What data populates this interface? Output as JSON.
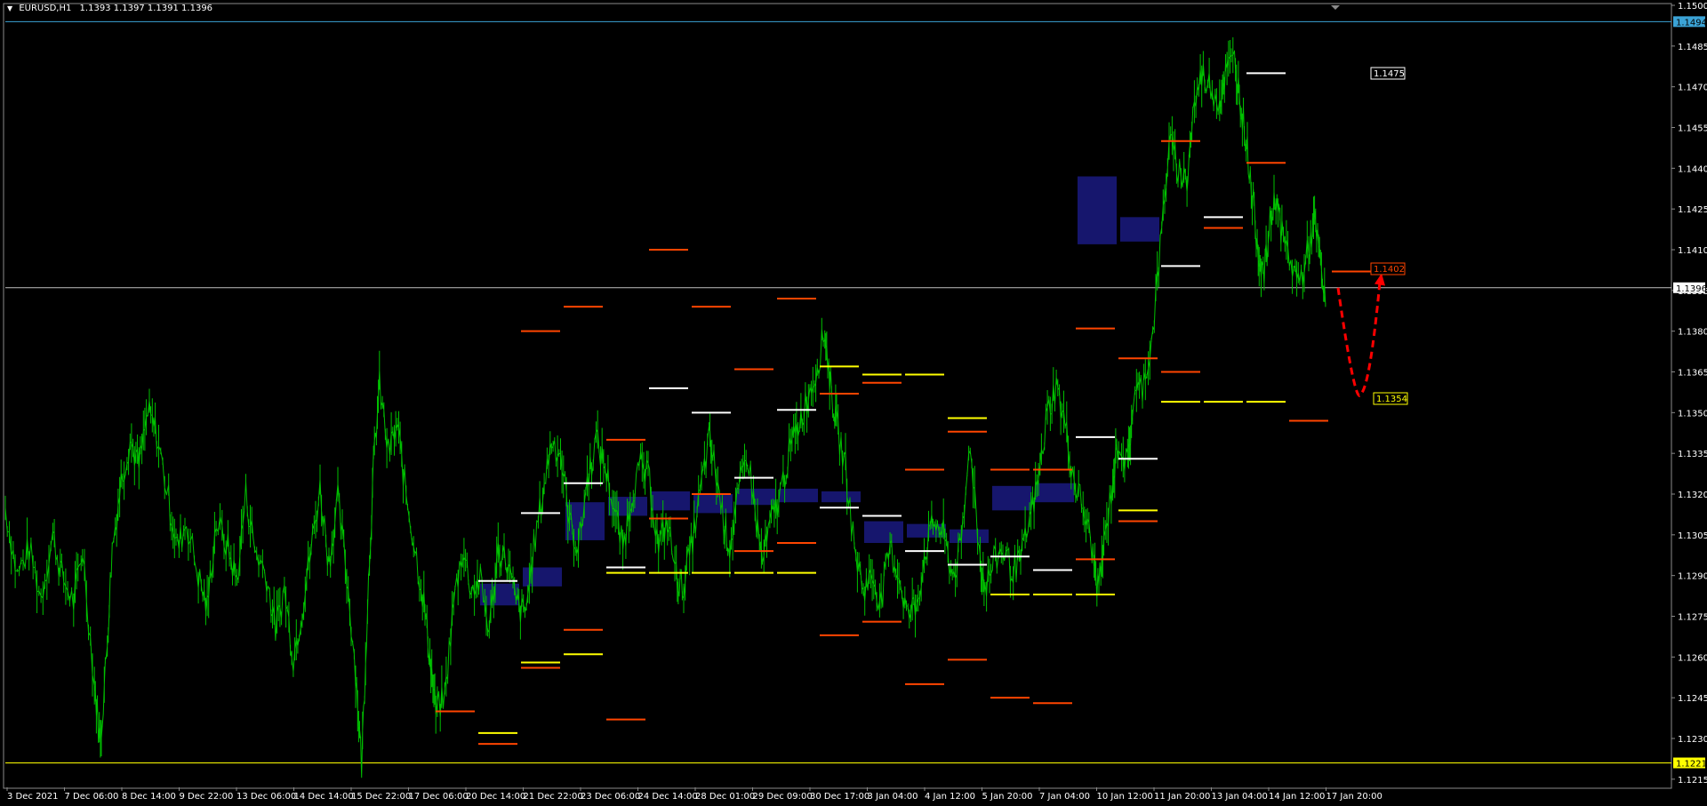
{
  "header": {
    "symbol": "EURUSD,H1",
    "ohlc": "1.1393 1.1397 1.1391 1.1396"
  },
  "colors": {
    "background": "#000000",
    "candles": "#00c000",
    "resistance": "#ff4500",
    "support": "#ffff00",
    "pivot": "#ffffff",
    "zone": "#1a1a80",
    "current_price": "#c0c0c0",
    "upper_line": "#3ba3d6",
    "lower_line": "#ffff00",
    "arrow": "#ff0000"
  },
  "price_axis": {
    "labels": [
      "1.1500",
      "1.1485",
      "1.1470",
      "1.1455",
      "1.1440",
      "1.1425",
      "1.1410",
      "1.1395",
      "1.1380",
      "1.1365",
      "1.1350",
      "1.1335",
      "1.1320",
      "1.1305",
      "1.1290",
      "1.1275",
      "1.1260",
      "1.1245",
      "1.1230",
      "1.1215"
    ],
    "highlighted": [
      {
        "value": "1.1494",
        "color": "#3ba3d6",
        "text_color": "#000000"
      },
      {
        "value": "1.1396",
        "color": "#ffffff",
        "text_color": "#000000"
      },
      {
        "value": "1.1221",
        "color": "#ffff00",
        "text_color": "#000000"
      }
    ]
  },
  "time_axis": {
    "labels": [
      "3 Dec 2021",
      "7 Dec 06:00",
      "8 Dec 14:00",
      "9 Dec 22:00",
      "13 Dec 06:00",
      "14 Dec 14:00",
      "15 Dec 22:00",
      "17 Dec 06:00",
      "20 Dec 14:00",
      "21 Dec 22:00",
      "23 Dec 06:00",
      "24 Dec 14:00",
      "28 Dec 01:00",
      "29 Dec 09:00",
      "30 Dec 17:00",
      "3 Jan 04:00",
      "4 Jan 12:00",
      "5 Jan 20:00",
      "7 Jan 04:00",
      "10 Jan 12:00",
      "11 Jan 20:00",
      "13 Jan 04:00",
      "14 Jan 12:00",
      "17 Jan 20:00"
    ]
  },
  "price_tags": {
    "upper": "1.1475",
    "middle": "1.1402",
    "lower": "1.1354"
  },
  "chart_data": {
    "type": "line",
    "ylim": [
      1.1212,
      1.15
    ],
    "upper_line": 1.1494,
    "lower_line": 1.1221,
    "current_price": 1.1396,
    "price_path": [
      [
        0,
        1.1315
      ],
      [
        8,
        1.129
      ],
      [
        16,
        1.13
      ],
      [
        24,
        1.1282
      ],
      [
        32,
        1.1305
      ],
      [
        38,
        1.129
      ],
      [
        46,
        1.128
      ],
      [
        52,
        1.13
      ],
      [
        60,
        1.125
      ],
      [
        64,
        1.1228
      ],
      [
        68,
        1.126
      ],
      [
        72,
        1.13
      ],
      [
        78,
        1.1325
      ],
      [
        84,
        1.134
      ],
      [
        90,
        1.133
      ],
      [
        96,
        1.135
      ],
      [
        102,
        1.1342
      ],
      [
        110,
        1.1318
      ],
      [
        116,
        1.13
      ],
      [
        122,
        1.131
      ],
      [
        130,
        1.129
      ],
      [
        136,
        1.1278
      ],
      [
        142,
        1.131
      ],
      [
        150,
        1.13
      ],
      [
        156,
        1.1288
      ],
      [
        162,
        1.132
      ],
      [
        168,
        1.13
      ],
      [
        176,
        1.129
      ],
      [
        182,
        1.127
      ],
      [
        188,
        1.1285
      ],
      [
        194,
        1.126
      ],
      [
        200,
        1.1278
      ],
      [
        206,
        1.13
      ],
      [
        212,
        1.1322
      ],
      [
        218,
        1.1295
      ],
      [
        224,
        1.1318
      ],
      [
        230,
        1.129
      ],
      [
        236,
        1.1255
      ],
      [
        240,
        1.122
      ],
      [
        244,
        1.128
      ],
      [
        248,
        1.133
      ],
      [
        252,
        1.136
      ],
      [
        258,
        1.1335
      ],
      [
        264,
        1.1345
      ],
      [
        270,
        1.132
      ],
      [
        276,
        1.13
      ],
      [
        282,
        1.128
      ],
      [
        286,
        1.126
      ],
      [
        290,
        1.124
      ],
      [
        296,
        1.1245
      ],
      [
        302,
        1.128
      ],
      [
        308,
        1.13
      ],
      [
        314,
        1.1285
      ],
      [
        320,
        1.1288
      ],
      [
        326,
        1.127
      ],
      [
        332,
        1.13
      ],
      [
        338,
        1.1295
      ],
      [
        344,
        1.128
      ],
      [
        350,
        1.1275
      ],
      [
        356,
        1.13
      ],
      [
        362,
        1.132
      ],
      [
        368,
        1.134
      ],
      [
        374,
        1.1335
      ],
      [
        380,
        1.131
      ],
      [
        386,
        1.13
      ],
      [
        392,
        1.1325
      ],
      [
        398,
        1.134
      ],
      [
        404,
        1.133
      ],
      [
        410,
        1.1315
      ],
      [
        416,
        1.13
      ],
      [
        422,
        1.132
      ],
      [
        428,
        1.133
      ],
      [
        434,
        1.1325
      ],
      [
        440,
        1.13
      ],
      [
        446,
        1.131
      ],
      [
        452,
        1.129
      ],
      [
        456,
        1.1285
      ],
      [
        462,
        1.13
      ],
      [
        468,
        1.132
      ],
      [
        474,
        1.134
      ],
      [
        478,
        1.133
      ],
      [
        484,
        1.131
      ],
      [
        488,
        1.13
      ],
      [
        494,
        1.132
      ],
      [
        500,
        1.1335
      ],
      [
        506,
        1.131
      ],
      [
        510,
        1.1295
      ],
      [
        516,
        1.131
      ],
      [
        522,
        1.132
      ],
      [
        528,
        1.1335
      ],
      [
        534,
        1.1345
      ],
      [
        540,
        1.1355
      ],
      [
        546,
        1.1365
      ],
      [
        552,
        1.138
      ],
      [
        556,
        1.136
      ],
      [
        560,
        1.1345
      ],
      [
        566,
        1.133
      ],
      [
        572,
        1.13
      ],
      [
        578,
        1.1285
      ],
      [
        584,
        1.129
      ],
      [
        590,
        1.128
      ],
      [
        596,
        1.13
      ],
      [
        602,
        1.129
      ],
      [
        608,
        1.1275
      ],
      [
        614,
        1.128
      ],
      [
        620,
        1.13
      ],
      [
        626,
        1.131
      ],
      [
        632,
        1.1305
      ],
      [
        638,
        1.129
      ],
      [
        644,
        1.13
      ],
      [
        650,
        1.134
      ],
      [
        656,
        1.13
      ],
      [
        660,
        1.1285
      ],
      [
        666,
        1.1295
      ],
      [
        672,
        1.13
      ],
      [
        678,
        1.1292
      ],
      [
        684,
        1.1295
      ],
      [
        690,
        1.131
      ],
      [
        696,
        1.1325
      ],
      [
        702,
        1.135
      ],
      [
        708,
        1.136
      ],
      [
        714,
        1.1345
      ],
      [
        720,
        1.1325
      ],
      [
        726,
        1.1315
      ],
      [
        732,
        1.13
      ],
      [
        736,
        1.1285
      ],
      [
        740,
        1.13
      ],
      [
        746,
        1.1325
      ],
      [
        750,
        1.134
      ],
      [
        756,
        1.133
      ],
      [
        760,
        1.1355
      ],
      [
        766,
        1.136
      ],
      [
        772,
        1.1375
      ],
      [
        778,
        1.141
      ],
      [
        784,
        1.145
      ],
      [
        790,
        1.144
      ],
      [
        796,
        1.1435
      ],
      [
        800,
        1.146
      ],
      [
        806,
        1.1475
      ],
      [
        812,
        1.147
      ],
      [
        818,
        1.1465
      ],
      [
        822,
        1.1475
      ],
      [
        828,
        1.148
      ],
      [
        832,
        1.1465
      ],
      [
        836,
        1.145
      ],
      [
        840,
        1.143
      ],
      [
        844,
        1.141
      ],
      [
        848,
        1.14
      ],
      [
        852,
        1.142
      ],
      [
        856,
        1.143
      ],
      [
        860,
        1.1415
      ],
      [
        866,
        1.1405
      ],
      [
        872,
        1.1398
      ],
      [
        878,
        1.141
      ],
      [
        882,
        1.142
      ],
      [
        886,
        1.1405
      ],
      [
        890,
        1.1385
      ]
    ],
    "resistance_levels": [
      [
        0,
        1.124
      ],
      [
        1,
        1.1228
      ],
      [
        2,
        1.1256
      ],
      [
        2,
        1.138
      ],
      [
        3,
        1.1389
      ],
      [
        3,
        1.127
      ],
      [
        4,
        1.134
      ],
      [
        4,
        1.1237
      ],
      [
        5,
        1.141
      ],
      [
        5,
        1.1311
      ],
      [
        6,
        1.1389
      ],
      [
        6,
        1.132
      ],
      [
        7,
        1.1299
      ],
      [
        7,
        1.1366
      ],
      [
        8,
        1.1392
      ],
      [
        8,
        1.1302
      ],
      [
        9,
        1.1357
      ],
      [
        9,
        1.1268
      ],
      [
        10,
        1.1361
      ],
      [
        10,
        1.1273
      ],
      [
        11,
        1.1329
      ],
      [
        11,
        1.125
      ],
      [
        12,
        1.1343
      ],
      [
        12,
        1.1259
      ],
      [
        13,
        1.1329
      ],
      [
        13,
        1.1245
      ],
      [
        14,
        1.1329
      ],
      [
        14,
        1.1243
      ],
      [
        15,
        1.1381
      ],
      [
        15,
        1.1296
      ],
      [
        16,
        1.137
      ],
      [
        16,
        1.131
      ],
      [
        17,
        1.1365
      ],
      [
        17,
        1.145
      ],
      [
        18,
        1.1418
      ],
      [
        19,
        1.1442
      ],
      [
        20,
        1.1347
      ],
      [
        21,
        1.1402
      ]
    ],
    "support_levels": [
      [
        1,
        1.1232
      ],
      [
        2,
        1.1258
      ],
      [
        3,
        1.1261
      ],
      [
        4,
        1.1291
      ],
      [
        5,
        1.1291
      ],
      [
        6,
        1.1291
      ],
      [
        7,
        1.1291
      ],
      [
        8,
        1.1291
      ],
      [
        9,
        1.1367
      ],
      [
        10,
        1.1364
      ],
      [
        11,
        1.1364
      ],
      [
        12,
        1.1348
      ],
      [
        13,
        1.1283
      ],
      [
        14,
        1.1283
      ],
      [
        15,
        1.1283
      ],
      [
        16,
        1.1314
      ],
      [
        17,
        1.1354
      ],
      [
        18,
        1.1354
      ],
      [
        19,
        1.1354
      ]
    ],
    "pivot_levels": [
      [
        1,
        1.1288
      ],
      [
        2,
        1.1313
      ],
      [
        3,
        1.1324
      ],
      [
        4,
        1.1293
      ],
      [
        5,
        1.1359
      ],
      [
        6,
        1.135
      ],
      [
        7,
        1.1326
      ],
      [
        8,
        1.1351
      ],
      [
        9,
        1.1315
      ],
      [
        10,
        1.1312
      ],
      [
        11,
        1.1299
      ],
      [
        12,
        1.1294
      ],
      [
        13,
        1.1297
      ],
      [
        14,
        1.1292
      ],
      [
        15,
        1.1341
      ],
      [
        16,
        1.1333
      ],
      [
        17,
        1.1404
      ],
      [
        18,
        1.1422
      ],
      [
        19,
        1.1475
      ]
    ],
    "zones": [
      [
        0,
        1.1287,
        1.1279
      ],
      [
        1,
        1.1293,
        1.1286
      ],
      [
        2,
        1.1317,
        1.1303
      ],
      [
        3,
        1.1319,
        1.1312
      ],
      [
        4,
        1.1321,
        1.1314
      ],
      [
        5,
        1.132,
        1.1313
      ],
      [
        6,
        1.1322,
        1.1316
      ],
      [
        7,
        1.1322,
        1.1317
      ],
      [
        8,
        1.1321,
        1.1317
      ],
      [
        9,
        1.131,
        1.1302
      ],
      [
        10,
        1.1309,
        1.1304
      ],
      [
        11,
        1.1307,
        1.1302
      ],
      [
        12,
        1.1323,
        1.1314
      ],
      [
        13,
        1.1324,
        1.1317
      ],
      [
        14,
        1.1437,
        1.1412
      ],
      [
        15,
        1.1422,
        1.1413
      ]
    ],
    "projection": {
      "from": 1.1396,
      "low": 1.1357,
      "to": 1.14
    }
  }
}
